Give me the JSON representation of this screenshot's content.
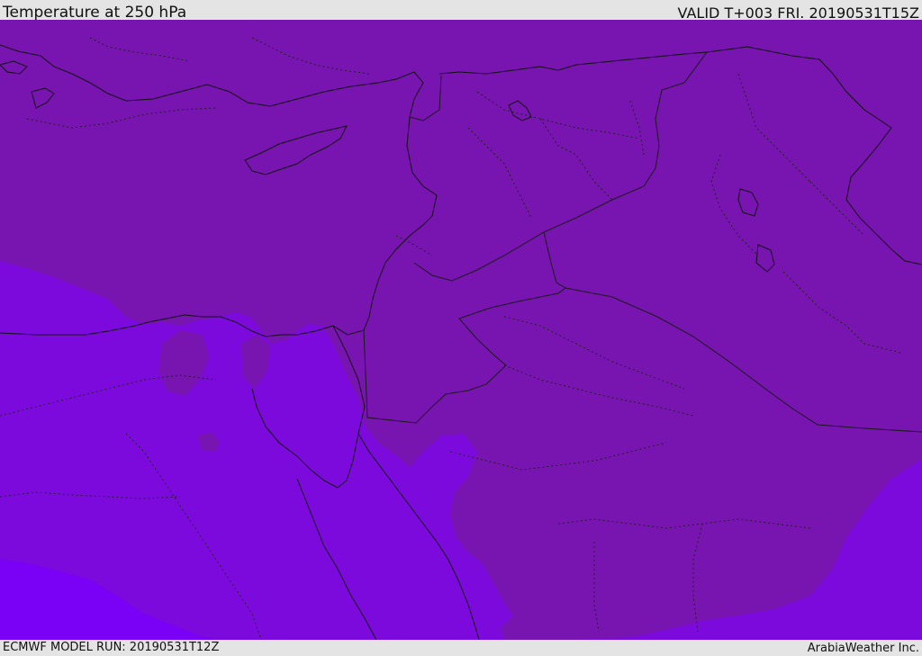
{
  "header": {
    "title": "Temperature at 250 hPa",
    "valid": "VALID T+003 FRI. 20190531T15Z"
  },
  "footer": {
    "model_run": "ECMWF MODEL RUN: 20190531T12Z",
    "credit": "ArabiaWeather Inc."
  },
  "map": {
    "field": "temperature",
    "level": "250 hPa",
    "colors": {
      "warm_band": "#7814b0",
      "mid_band": "#7d0adc",
      "cool_band": "#7a00f6",
      "coast_line": "#111111",
      "border_line": "#1a1a1a"
    }
  }
}
